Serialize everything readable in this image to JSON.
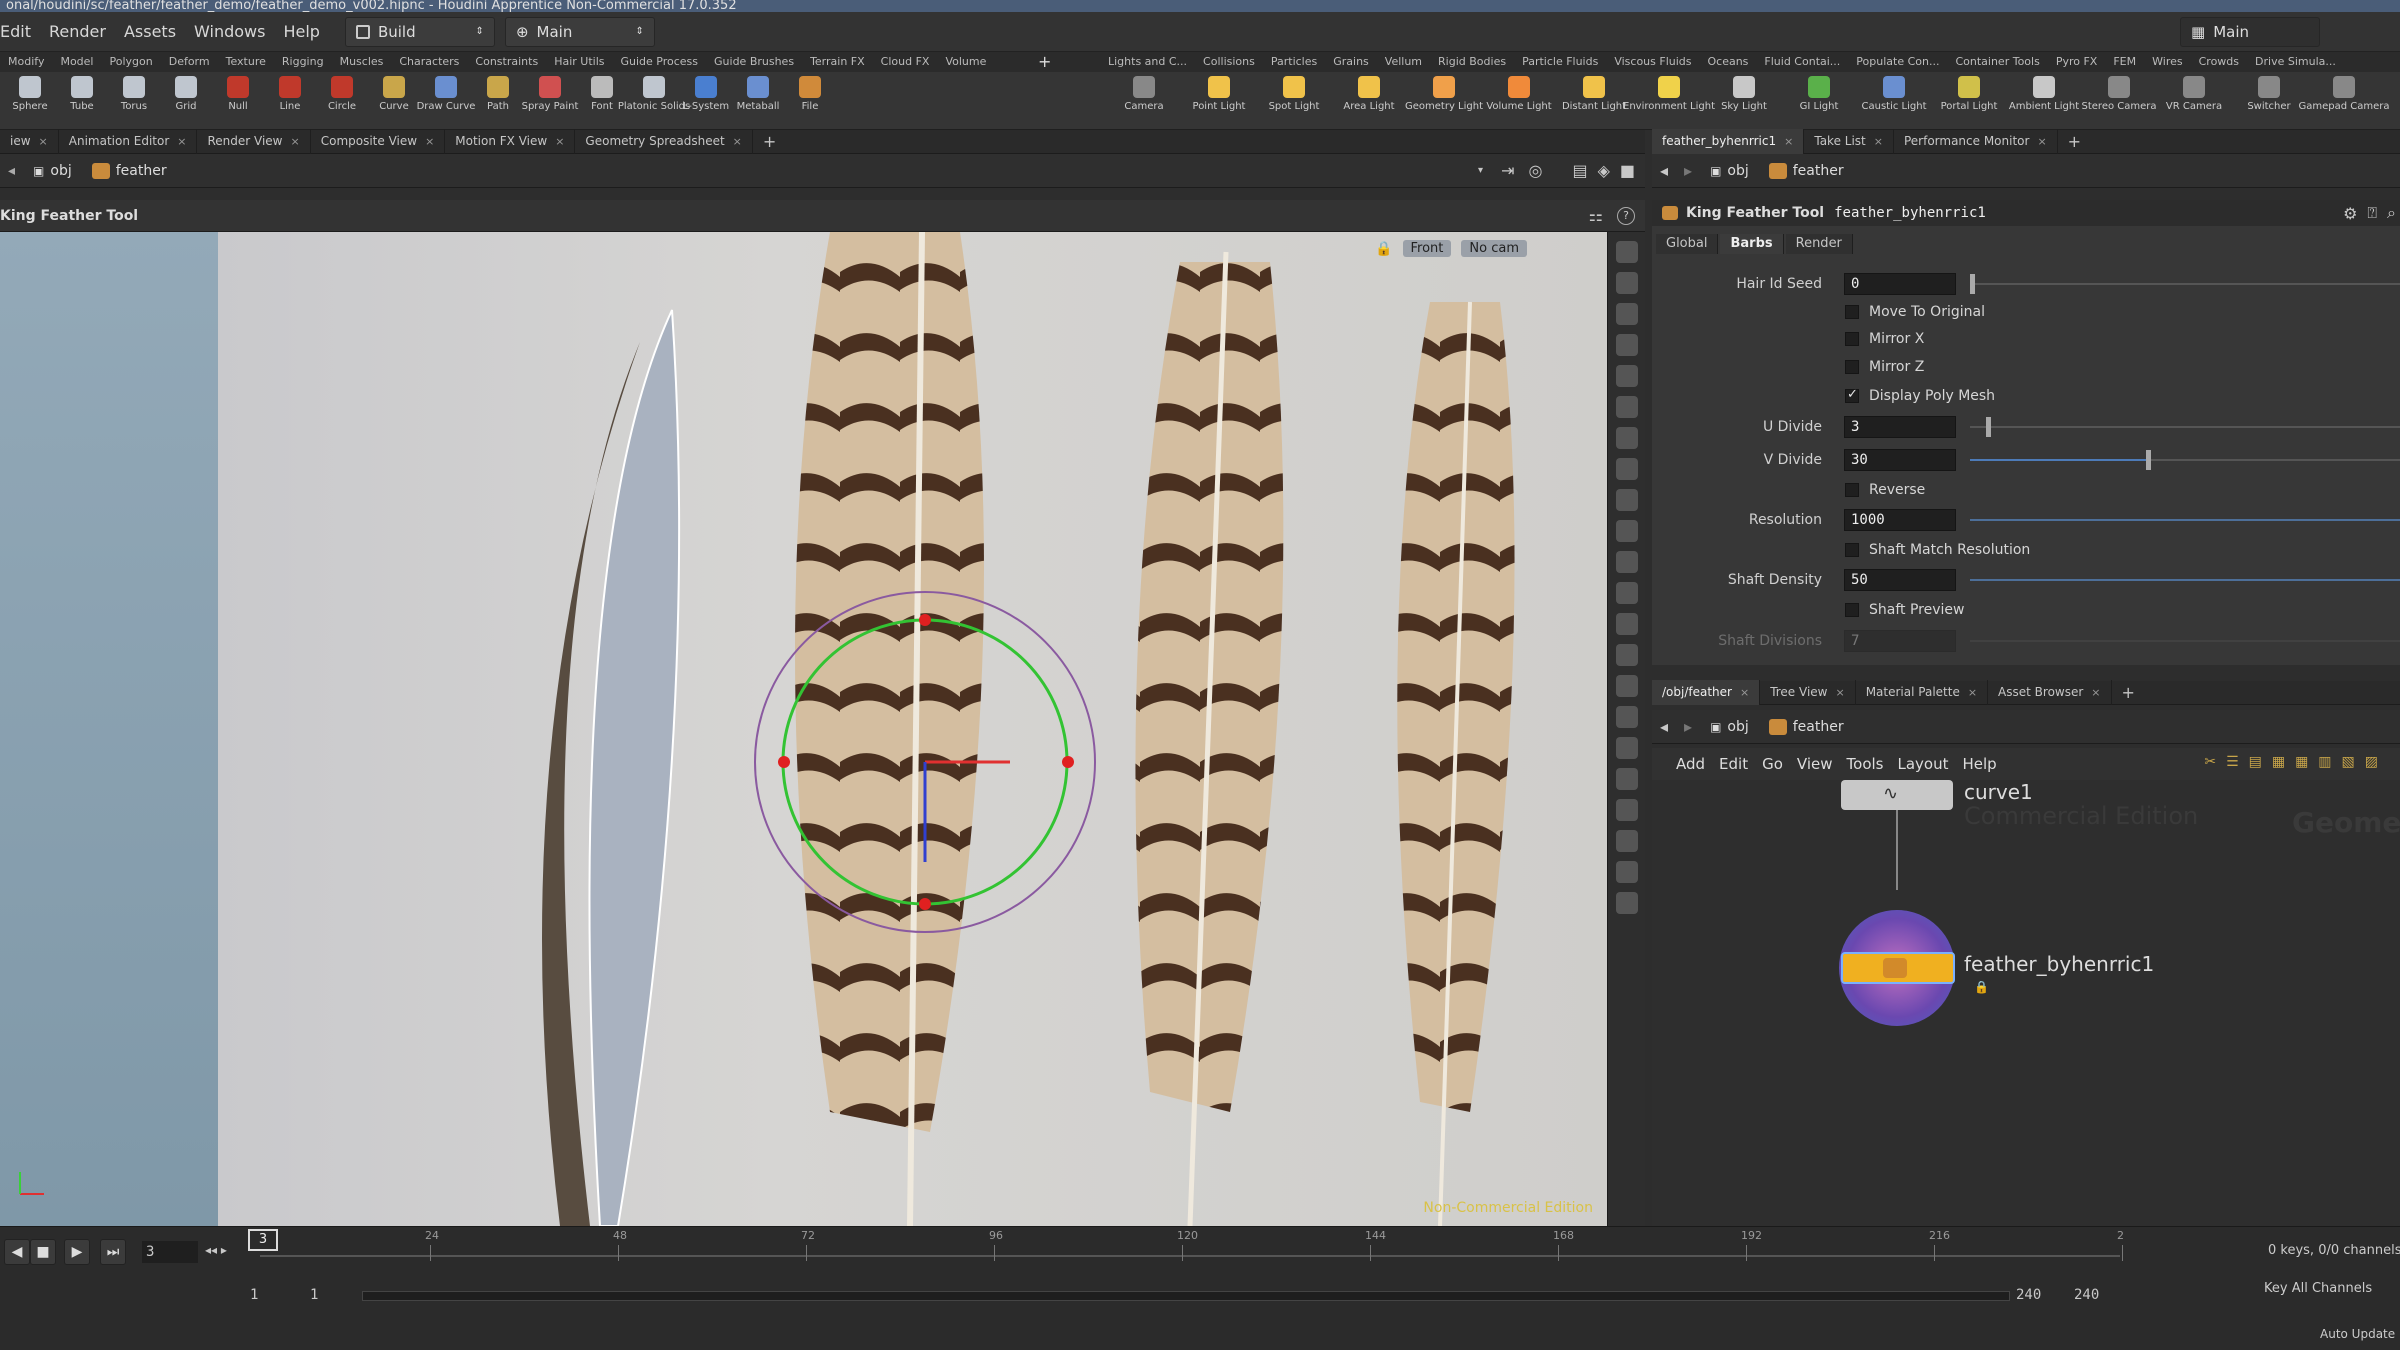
{
  "titlebar": {
    "text": "onal/houdini/sc/feather/feather_demo/feather_demo_v002.hipnc - Houdini Apprentice Non-Commercial 17.0.352"
  },
  "menu": {
    "items": [
      "Edit",
      "Render",
      "Assets",
      "Windows",
      "Help"
    ],
    "desktop": "Build",
    "context": "Main",
    "right_desk": "Main"
  },
  "shelf_tabs_left": [
    "Modify",
    "Model",
    "Polygon",
    "Deform",
    "Texture",
    "Rigging",
    "Muscles",
    "Characters",
    "Constraints",
    "Hair Utils",
    "Guide Process",
    "Guide Brushes",
    "Terrain FX",
    "Cloud FX",
    "Volume"
  ],
  "shelf_tabs_right": [
    "Lights and C...",
    "Collisions",
    "Particles",
    "Grains",
    "Vellum",
    "Rigid Bodies",
    "Particle Fluids",
    "Viscous Fluids",
    "Oceans",
    "Fluid Contai...",
    "Populate Con...",
    "Container Tools",
    "Pyro FX",
    "FEM",
    "Wires",
    "Crowds",
    "Drive Simula..."
  ],
  "shelf_tools_left": [
    {
      "label": "Sphere",
      "icon": "sphere-icon",
      "color": "#bfc6cf"
    },
    {
      "label": "Tube",
      "icon": "tube-icon",
      "color": "#bfc6cf"
    },
    {
      "label": "Torus",
      "icon": "torus-icon",
      "color": "#bfc6cf"
    },
    {
      "label": "Grid",
      "icon": "grid-icon",
      "color": "#bfc6cf"
    },
    {
      "label": "Null",
      "icon": "null-icon",
      "color": "#c0392b"
    },
    {
      "label": "Line",
      "icon": "line-icon",
      "color": "#c0392b"
    },
    {
      "label": "Circle",
      "icon": "circle-icon",
      "color": "#c0392b"
    },
    {
      "label": "Curve",
      "icon": "curve-icon",
      "color": "#c9a64a"
    },
    {
      "label": "Draw Curve",
      "icon": "draw-curve-icon",
      "color": "#6a8fd0"
    },
    {
      "label": "Path",
      "icon": "path-icon",
      "color": "#c9a64a"
    },
    {
      "label": "Spray Paint",
      "icon": "spray-paint-icon",
      "color": "#d05050"
    },
    {
      "label": "Font",
      "icon": "font-icon",
      "color": "#bbbbbb"
    },
    {
      "label": "Platonic Solids",
      "icon": "platonic-solids-icon",
      "color": "#bfc6cf"
    },
    {
      "label": "L-System",
      "icon": "lsystem-icon",
      "color": "#4a7fd0"
    },
    {
      "label": "Metaball",
      "icon": "metaball-icon",
      "color": "#6a8fd0"
    },
    {
      "label": "File",
      "icon": "file-icon",
      "color": "#d08a3a"
    }
  ],
  "shelf_tools_right": [
    {
      "label": "Camera",
      "icon": "camera-icon",
      "color": "#888888"
    },
    {
      "label": "Point Light",
      "icon": "point-light-icon",
      "color": "#f0c24a"
    },
    {
      "label": "Spot Light",
      "icon": "spot-light-icon",
      "color": "#f0c24a"
    },
    {
      "label": "Area Light",
      "icon": "area-light-icon",
      "color": "#f0c24a"
    },
    {
      "label": "Geometry Light",
      "icon": "geometry-light-icon",
      "color": "#f0a04a"
    },
    {
      "label": "Volume Light",
      "icon": "volume-light-icon",
      "color": "#f08a3a"
    },
    {
      "label": "Distant Light",
      "icon": "distant-light-icon",
      "color": "#f0c24a"
    },
    {
      "label": "Environment Light",
      "icon": "environment-light-icon",
      "color": "#f0d24a"
    },
    {
      "label": "Sky Light",
      "icon": "sky-light-icon",
      "color": "#c8c8c8"
    },
    {
      "label": "GI Light",
      "icon": "gi-light-icon",
      "color": "#5ab04a"
    },
    {
      "label": "Caustic Light",
      "icon": "caustic-light-icon",
      "color": "#6a8fd0"
    },
    {
      "label": "Portal Light",
      "icon": "portal-light-icon",
      "color": "#d0c04a"
    },
    {
      "label": "Ambient Light",
      "icon": "ambient-light-icon",
      "color": "#c8c8c8"
    },
    {
      "label": "Stereo Camera",
      "icon": "stereo-camera-icon",
      "color": "#888888"
    },
    {
      "label": "VR Camera",
      "icon": "vr-camera-icon",
      "color": "#888888"
    },
    {
      "label": "Switcher",
      "icon": "switcher-icon",
      "color": "#888888"
    },
    {
      "label": "Gamepad Camera",
      "icon": "gamepad-camera-icon",
      "color": "#888888"
    }
  ],
  "left_tabs": [
    "iew",
    "Animation Editor",
    "Render View",
    "Composite View",
    "Motion FX View",
    "Geometry Spreadsheet"
  ],
  "left_path": {
    "obj": "obj",
    "node": "feather"
  },
  "viewport": {
    "tool_title": "King Feather Tool",
    "view": "Front",
    "camera": "No cam",
    "watermark": "Non-Commercial Edition"
  },
  "param_tabs_top": [
    "feather_byhenrric1",
    "Take List",
    "Performance Monitor"
  ],
  "param_path": {
    "obj": "obj",
    "node": "feather"
  },
  "param_header": {
    "type": "King Feather Tool",
    "name": "feather_byhenrric1"
  },
  "param_tabs": [
    "Global",
    "Barbs",
    "Render"
  ],
  "params": {
    "hair_id_seed": {
      "label": "Hair Id Seed",
      "value": "0"
    },
    "move_to_original": {
      "label": "Move To Original"
    },
    "mirror_x": {
      "label": "Mirror X"
    },
    "mirror_z": {
      "label": "Mirror Z"
    },
    "display_poly_mesh": {
      "label": "Display Poly Mesh",
      "checked": true
    },
    "u_divide": {
      "label": "U Divide",
      "value": "3"
    },
    "v_divide": {
      "label": "V Divide",
      "value": "30"
    },
    "reverse": {
      "label": "Reverse"
    },
    "resolution": {
      "label": "Resolution",
      "value": "1000"
    },
    "shaft_match_resolution": {
      "label": "Shaft Match Resolution"
    },
    "shaft_density": {
      "label": "Shaft Density",
      "value": "50"
    },
    "shaft_preview": {
      "label": "Shaft Preview"
    },
    "shaft_divisions": {
      "label": "Shaft Divisions",
      "value": "7"
    }
  },
  "net_tabs": [
    "/obj/feather",
    "Tree View",
    "Material Palette",
    "Asset Browser"
  ],
  "net_path": {
    "obj": "obj",
    "node": "feather"
  },
  "net_menu": [
    "Add",
    "Edit",
    "Go",
    "View",
    "Tools",
    "Layout",
    "Help"
  ],
  "net_watermark": "Commercial Edition",
  "net_watermark2": "Geomet",
  "nodes": {
    "curve": "curve1",
    "feather": "feather_byhenrric1"
  },
  "timeline": {
    "current_frame": "3",
    "marker": "3",
    "ticks": [
      "24",
      "48",
      "72",
      "96",
      "120",
      "144",
      "168",
      "192",
      "216",
      "2"
    ],
    "start": "1",
    "range_start": "1",
    "range_end": "240",
    "end": "240",
    "keys": "0 keys, 0/0 channels",
    "key_all": "Key All Channels",
    "auto_update": "Auto Update"
  }
}
